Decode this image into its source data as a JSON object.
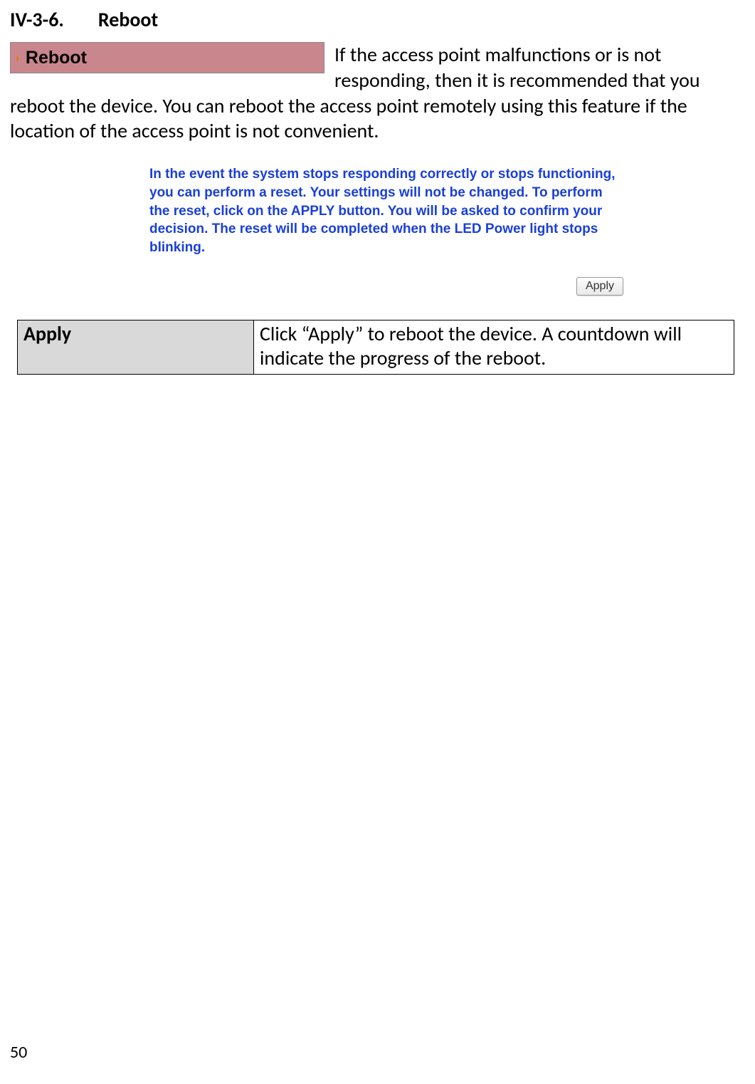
{
  "heading": {
    "number": "IV-3-6.",
    "title": "Reboot"
  },
  "menu_badge": {
    "caret": "›",
    "label": "Reboot"
  },
  "intro_text": "If the access point malfunctions or is not responding, then it is recommended that you reboot the device. You can reboot the access point remotely using this feature if the location of the access point is not convenient.",
  "blue_note": "In the event the system stops responding correctly or stops functioning, you can perform a reset. Your settings will not be changed. To perform the reset, click on the APPLY button. You will be asked to confirm your decision. The reset will be completed when the LED Power light stops blinking.",
  "apply_button": "Apply",
  "param_table": {
    "name": "Apply",
    "desc": "Click “Apply” to reboot the device. A countdown will indicate the progress of the reboot."
  },
  "page_number": "50"
}
